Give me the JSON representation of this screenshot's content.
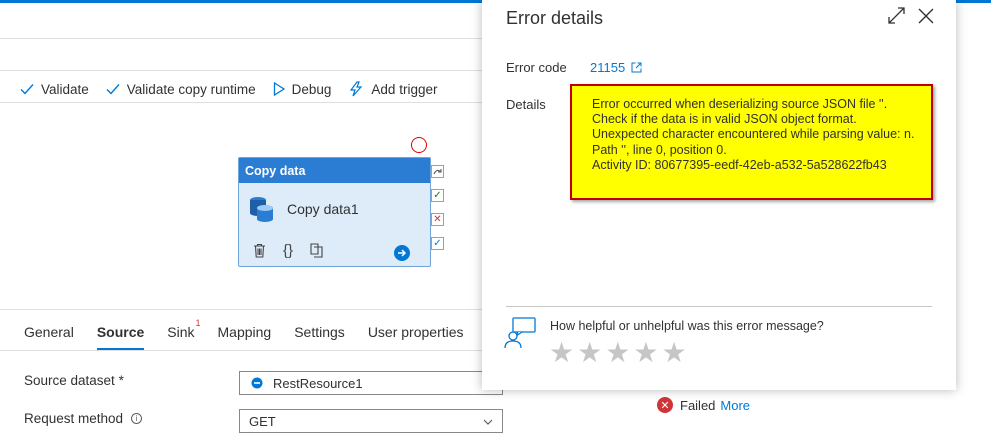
{
  "toolbar": {
    "validate": "Validate",
    "validate_runtime": "Validate copy runtime",
    "debug": "Debug",
    "add_trigger": "Add trigger"
  },
  "activity": {
    "type": "Copy data",
    "name": "Copy data1"
  },
  "tabs": {
    "general": "General",
    "source": "Source",
    "sink": "Sink",
    "sink_badge": "1",
    "mapping": "Mapping",
    "settings": "Settings",
    "user_properties": "User properties"
  },
  "form": {
    "source_dataset_label": "Source dataset",
    "required_mark": "*",
    "source_dataset_value": "RestResource1",
    "request_method_label": "Request method",
    "request_method_info": "i",
    "request_method_value": "GET"
  },
  "status": {
    "text": "Failed",
    "more": "More"
  },
  "error_panel": {
    "title": "Error details",
    "error_code_label": "Error code",
    "error_code": "21155",
    "details_label": "Details",
    "details_lines": [
      "Error occurred when deserializing source JSON file ''.",
      "Check if the data is in valid JSON object format.",
      "Unexpected character encountered while parsing value: n.",
      "Path '', line 0, position 0.",
      "Activity ID: 80677395-eedf-42eb-a532-5a528622fb43"
    ],
    "feedback_question": "How helpful or unhelpful was this error message?",
    "star_count": 5
  },
  "colors": {
    "accent": "#0078d4",
    "activity_header": "#2b7cd3",
    "highlight": "#ffff00",
    "highlight_border": "#c00000",
    "error": "#d13438"
  }
}
